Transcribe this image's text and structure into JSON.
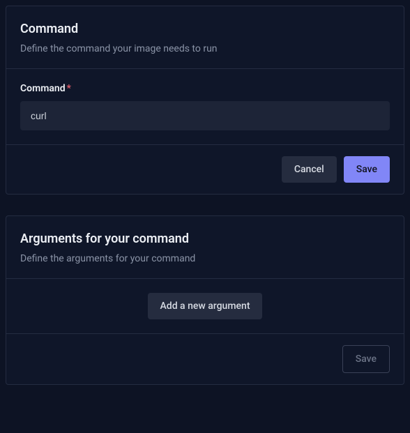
{
  "command_card": {
    "title": "Command",
    "description": "Define the command your image needs to run",
    "field_label": "Command",
    "required_mark": "*",
    "value": "curl",
    "cancel_label": "Cancel",
    "save_label": "Save"
  },
  "arguments_card": {
    "title": "Arguments for your command",
    "description": "Define the arguments for your command",
    "add_label": "Add a new argument",
    "save_label": "Save"
  }
}
